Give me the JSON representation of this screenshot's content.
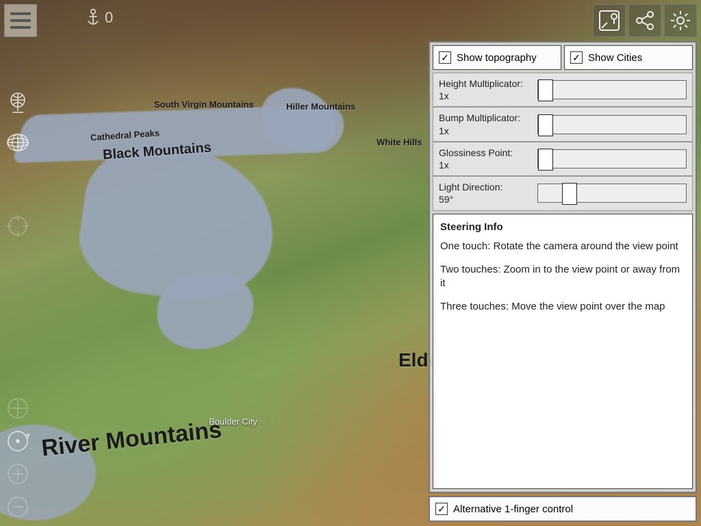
{
  "anchor_count": "0",
  "top_buttons": {
    "maps": "maps-icon",
    "share": "share-icon",
    "settings": "gear-icon"
  },
  "map_labels": {
    "river_mountains": "River Mountains",
    "black_mountains": "Black Mountains",
    "cathedral_peaks": "Cathedral Peaks",
    "south_virgin": "South Virgin Mountains",
    "hiller": "Hiller Mountains",
    "white_hills": "White Hills",
    "eldorado": "Eldorado",
    "boulder_city": "Boulder City"
  },
  "toggles": {
    "show_topography": {
      "label": "Show topography",
      "checked": true
    },
    "show_cities": {
      "label": "Show Cities",
      "checked": true
    }
  },
  "sliders": [
    {
      "key": "height",
      "label": "Height Multiplicator:",
      "value_text": "1x",
      "thumb_pct": 0
    },
    {
      "key": "bump",
      "label": "Bump Multiplicator:",
      "value_text": "1x",
      "thumb_pct": 0
    },
    {
      "key": "gloss",
      "label": "Glossiness Point:",
      "value_text": "1x",
      "thumb_pct": 0
    },
    {
      "key": "light",
      "label": "Light Direction:",
      "value_text": "59°",
      "thumb_pct": 16
    }
  ],
  "steering": {
    "title": "Steering Info",
    "lines": [
      "One touch: Rotate the camera around the view point",
      "Two touches: Zoom in to the view point or away from it",
      "Three touches: Move the view point over the map"
    ]
  },
  "alt_control": {
    "label": "Alternative 1-finger control",
    "checked": true
  }
}
